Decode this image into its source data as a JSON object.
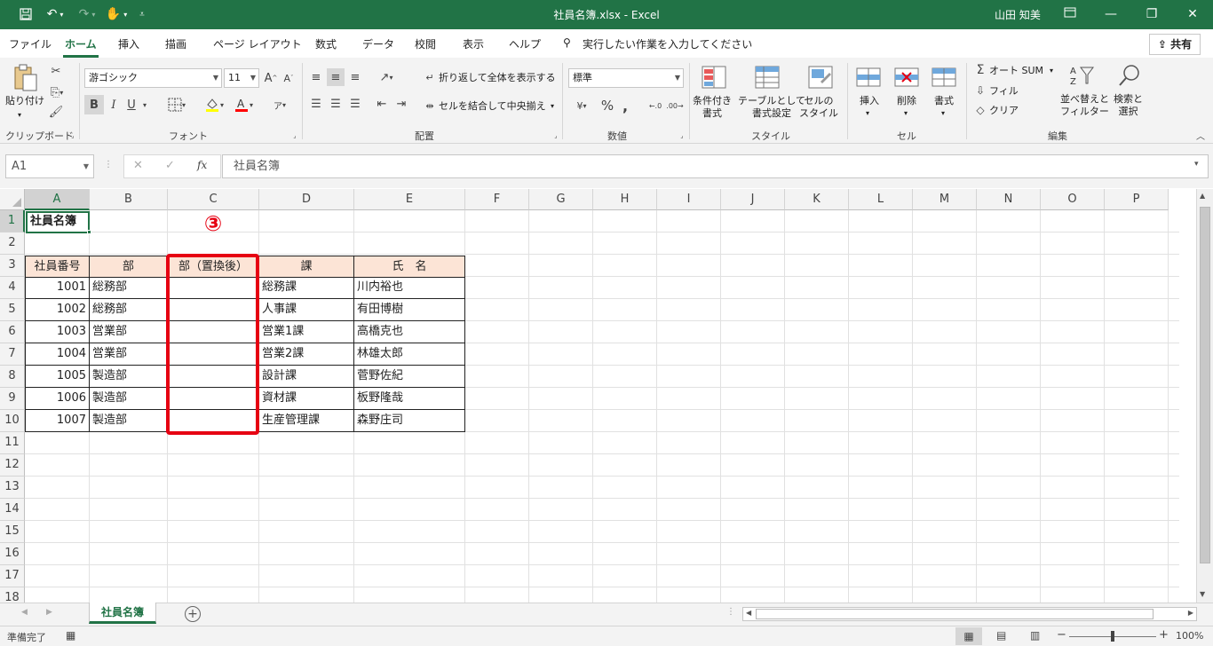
{
  "window": {
    "title": "社員名簿.xlsx  -  Excel",
    "user": "山田 知美"
  },
  "tabs": [
    "ファイル",
    "ホーム",
    "挿入",
    "描画",
    "ページ レイアウト",
    "数式",
    "データ",
    "校閲",
    "表示",
    "ヘルプ"
  ],
  "search_tab": "実行したい作業を入力してください",
  "share_label": "共有",
  "ribbon": {
    "clipboard": {
      "paste": "貼り付け",
      "label": "クリップボード"
    },
    "font": {
      "name": "游ゴシック",
      "size": "11",
      "label": "フォント",
      "bold": "B",
      "italic": "I",
      "underline": "U"
    },
    "alignment": {
      "wrap": "折り返して全体を表示する",
      "merge": "セルを結合して中央揃え",
      "label": "配置"
    },
    "number": {
      "format": "標準",
      "label": "数値"
    },
    "styles": {
      "conditional": "条件付き\n書式",
      "table": "テーブルとして\n書式設定",
      "cell": "セルの\nスタイル",
      "label": "スタイル"
    },
    "cells": {
      "insert": "挿入",
      "delete": "削除",
      "format": "書式",
      "label": "セル"
    },
    "editing": {
      "autosum": "オート SUM",
      "fill": "フィル",
      "clear": "クリア",
      "sort": "並べ替えと\nフィルター",
      "find": "検索と\n選択",
      "label": "編集"
    }
  },
  "namebox": "A1",
  "formula": "社員名簿",
  "columns": [
    "A",
    "B",
    "C",
    "D",
    "E",
    "F",
    "G",
    "H",
    "I",
    "J",
    "K",
    "L",
    "M",
    "N",
    "O",
    "P"
  ],
  "rows": [
    "1",
    "2",
    "3",
    "4",
    "5",
    "6",
    "7",
    "8",
    "9",
    "10",
    "11",
    "12",
    "13",
    "14",
    "15",
    "16",
    "17",
    "18"
  ],
  "sheet": {
    "title": "社員名簿",
    "headers": [
      "社員番号",
      "部",
      "部（置換後）",
      "課",
      "氏　名"
    ],
    "records": [
      {
        "id": "1001",
        "dept": "総務部",
        "after": "",
        "section": "総務課",
        "name": "川内裕也"
      },
      {
        "id": "1002",
        "dept": "総務部",
        "after": "",
        "section": "人事課",
        "name": "有田博樹"
      },
      {
        "id": "1003",
        "dept": "営業部",
        "after": "",
        "section": "営業1課",
        "name": "高橋克也"
      },
      {
        "id": "1004",
        "dept": "営業部",
        "after": "",
        "section": "営業2課",
        "name": "林雄太郎"
      },
      {
        "id": "1005",
        "dept": "製造部",
        "after": "",
        "section": "設計課",
        "name": "菅野佐紀"
      },
      {
        "id": "1006",
        "dept": "製造部",
        "after": "",
        "section": "資材課",
        "name": "板野隆哉"
      },
      {
        "id": "1007",
        "dept": "製造部",
        "after": "",
        "section": "生産管理課",
        "name": "森野庄司"
      }
    ]
  },
  "annotation": "③",
  "sheet_tab": "社員名簿",
  "status": {
    "ready": "準備完了",
    "zoom": "100%"
  },
  "colors": {
    "accent": "#217346",
    "header_fill": "#fce4d6",
    "highlight": "#e60012"
  }
}
